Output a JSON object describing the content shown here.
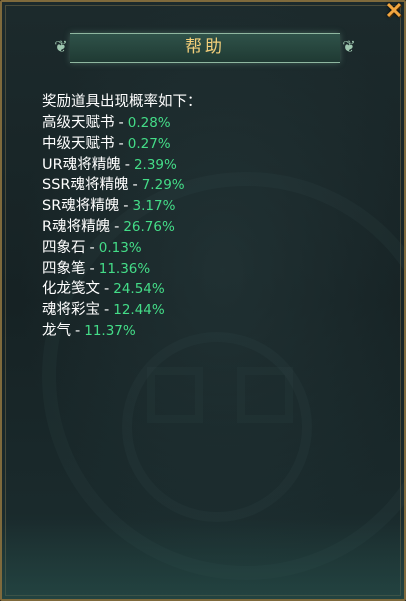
{
  "dialog": {
    "title": "帮助",
    "close_icon": "close-x-icon",
    "accent_color": "#f3cf7a",
    "percent_color": "#44dd88"
  },
  "content": {
    "heading": "奖励道具出现概率如下：",
    "separator": "-",
    "items": [
      {
        "name": "高级天赋书",
        "rate": "0.28%"
      },
      {
        "name": "中级天赋书",
        "rate": "0.27%"
      },
      {
        "name": "UR魂将精魄",
        "rate": "2.39%"
      },
      {
        "name": "SSR魂将精魄",
        "rate": "7.29%"
      },
      {
        "name": "SR魂将精魄",
        "rate": "3.17%"
      },
      {
        "name": "R魂将精魄",
        "rate": "26.76%"
      },
      {
        "name": "四象石",
        "rate": "0.13%"
      },
      {
        "name": "四象笔",
        "rate": "11.36%"
      },
      {
        "name": "化龙笺文",
        "rate": "24.54%"
      },
      {
        "name": "魂将彩宝",
        "rate": "12.44%"
      },
      {
        "name": "龙气",
        "rate": "11.37%"
      }
    ]
  }
}
